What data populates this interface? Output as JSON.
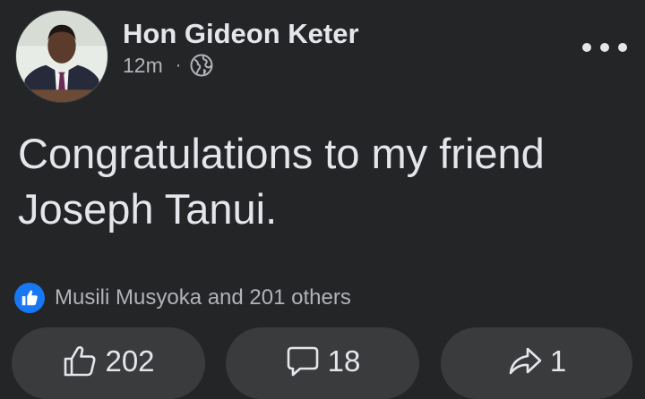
{
  "post": {
    "author": "Hon Gideon Keter",
    "time": "12m",
    "separator": "·",
    "privacy_icon": "globe-icon",
    "text": "Congratulations to my friend Joseph Tanui.",
    "menu_icon": "more-options-icon"
  },
  "reactions": {
    "icon": "like-badge-icon",
    "summary": "Musili Musyoka and 201 others"
  },
  "actions": {
    "like": {
      "icon": "thumbs-up-icon",
      "count": "202"
    },
    "comment": {
      "icon": "comment-icon",
      "count": "18"
    },
    "share": {
      "icon": "share-arrow-icon",
      "count": "1"
    }
  },
  "colors": {
    "background": "#242526",
    "text_primary": "#e4e6eb",
    "text_secondary": "#b0b3b8",
    "button_bg": "#3a3b3c",
    "like_blue": "#1877f2"
  }
}
